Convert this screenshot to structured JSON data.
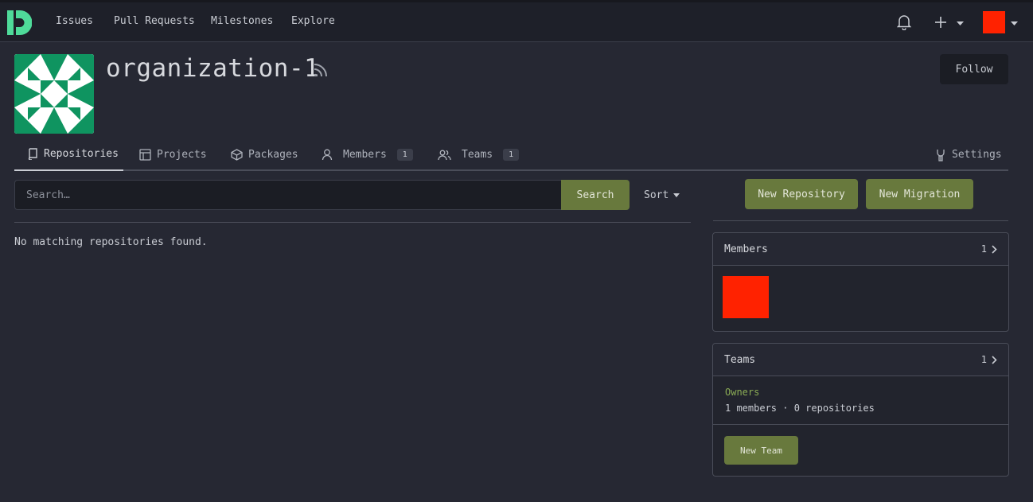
{
  "nav": {
    "links": [
      "Issues",
      "Pull Requests",
      "Milestones",
      "Explore"
    ]
  },
  "org": {
    "name": "organization-1",
    "follow_label": "Follow"
  },
  "tabs": {
    "repositories": "Repositories",
    "projects": "Projects",
    "packages": "Packages",
    "members": "Members",
    "members_count": "1",
    "teams": "Teams",
    "teams_count": "1",
    "settings": "Settings"
  },
  "search": {
    "placeholder": "Search…",
    "button": "Search",
    "sort": "Sort"
  },
  "repos": {
    "empty": "No matching repositories found."
  },
  "actions": {
    "new_repository": "New Repository",
    "new_migration": "New Migration"
  },
  "members_card": {
    "title": "Members",
    "count": "1"
  },
  "teams_card": {
    "title": "Teams",
    "count": "1",
    "team_name": "Owners",
    "team_meta": "1 members · 0 repositories",
    "new_team": "New Team"
  },
  "colors": {
    "brand_logo": "#4fdb9a",
    "accent_green": "#68793d",
    "avatar_red": "#ff2200",
    "org_avatar_green": "#0f9460"
  },
  "icons": [
    "gitea-logo-icon",
    "bell-icon",
    "plus-icon",
    "caret-down-icon",
    "rss-icon",
    "repo-icon",
    "project-icon",
    "package-icon",
    "person-icon",
    "people-icon",
    "tools-icon",
    "chevron-right-icon"
  ]
}
